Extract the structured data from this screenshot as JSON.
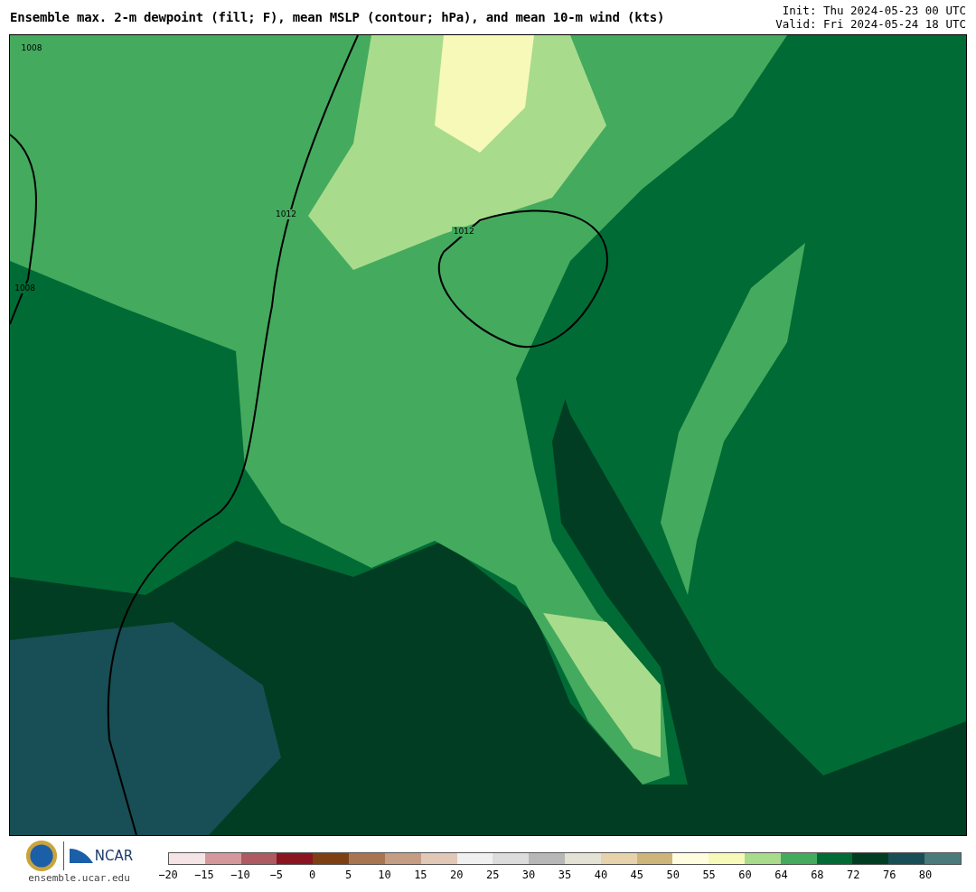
{
  "title": "Ensemble max. 2-m dewpoint (fill; F), mean MSLP (contour; hPa), and mean 10-m wind (kts)",
  "init": "Init: Thu 2024-05-23 00 UTC",
  "valid": "Valid: Fri 2024-05-24 18 UTC",
  "map": {
    "contour_labels": [
      "1008",
      "1012",
      "1012",
      "1008"
    ]
  },
  "footer": {
    "ncar": "NCAR",
    "site": "ensemble.ucar.edu"
  },
  "colorbar": {
    "segments": [
      {
        "color": "#f5e4e5"
      },
      {
        "color": "#d4989c"
      },
      {
        "color": "#ad5a60"
      },
      {
        "color": "#8a1520"
      },
      {
        "color": "#7e3f12"
      },
      {
        "color": "#a87550"
      },
      {
        "color": "#c49d82"
      },
      {
        "color": "#e2c8b7"
      },
      {
        "color": "#f0f0f0"
      },
      {
        "color": "#dcdcdc"
      },
      {
        "color": "#b7b7b7"
      },
      {
        "color": "#e4e1d5"
      },
      {
        "color": "#e6d3ac"
      },
      {
        "color": "#cdb57a"
      },
      {
        "color": "#fffce0"
      },
      {
        "color": "#f7f9b8"
      },
      {
        "color": "#a8dc8c"
      },
      {
        "color": "#44aa5e"
      },
      {
        "color": "#016b35"
      },
      {
        "color": "#013d22"
      },
      {
        "color": "#184e55"
      },
      {
        "color": "#4a7a7a"
      }
    ],
    "ticks": [
      "−20",
      "−15",
      "−10",
      "−5",
      "0",
      "5",
      "10",
      "15",
      "20",
      "25",
      "30",
      "35",
      "40",
      "45",
      "50",
      "55",
      "60",
      "64",
      "68",
      "72",
      "76",
      "80"
    ]
  }
}
